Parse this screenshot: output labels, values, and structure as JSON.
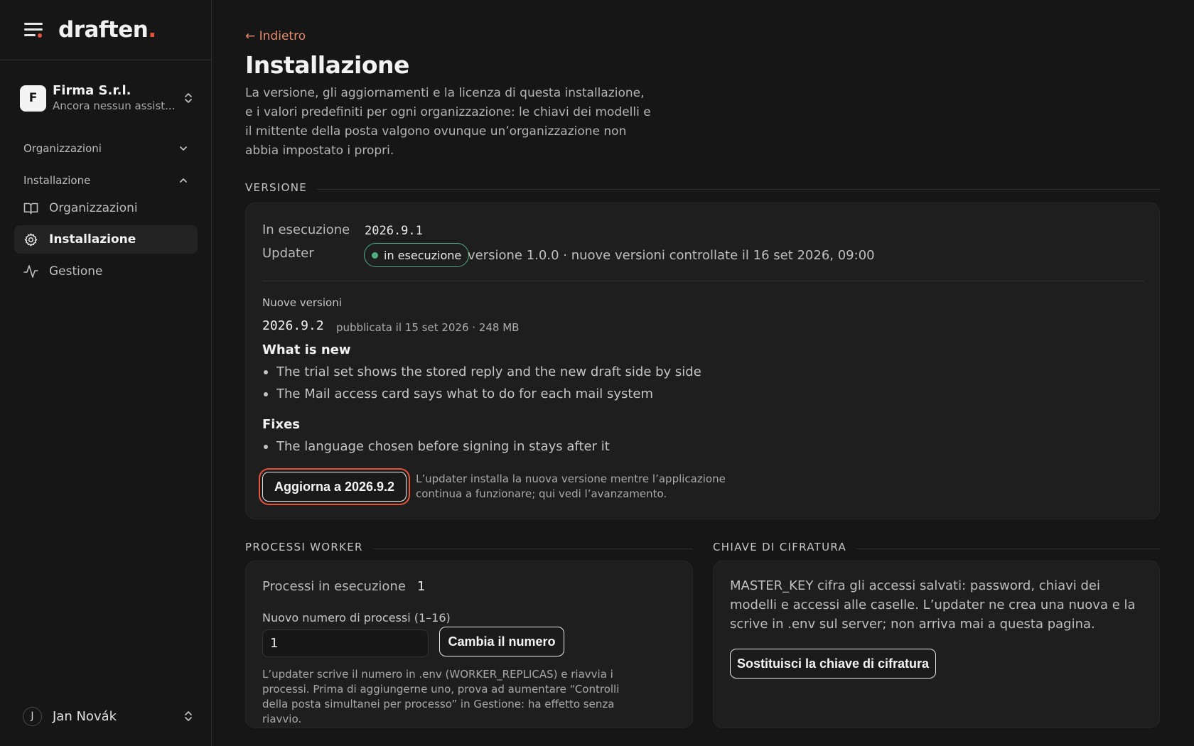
{
  "brand": {
    "name": "draften",
    "accent_color": "#e5533d"
  },
  "org": {
    "initial": "F",
    "name": "Firma S.r.l.",
    "subtitle": "Ancora nessun assist..."
  },
  "nav": {
    "sections": [
      {
        "label": "Organizzazioni",
        "expanded": false
      },
      {
        "label": "Installazione",
        "expanded": true
      }
    ],
    "items": [
      {
        "label": "Organizzazioni",
        "icon": "book-icon",
        "active": false
      },
      {
        "label": "Installazione",
        "icon": "gear-icon",
        "active": true
      },
      {
        "label": "Gestione",
        "icon": "activity-icon",
        "active": false
      }
    ]
  },
  "user": {
    "initial": "J",
    "name": "Jan Novák"
  },
  "page": {
    "back": "← Indietro",
    "title": "Installazione",
    "description": "La versione, gli aggiornamenti e la licenza di questa installazione, e i valori predefiniti per ogni organizzazione: le chiavi dei modelli e il mittente della posta valgono ovunque un’organizzazione non abbia impostato i propri."
  },
  "version": {
    "section_label": "VERSIONE",
    "running_label": "In esecuzione",
    "running_value": "2026.9.1",
    "updater_label": "Updater",
    "updater_status": "in esecuzione",
    "updater_status_color": "#4fae83",
    "updater_info": "versione 1.0.0 · nuove versioni controllate il 16 set 2026, 09:00",
    "new_versions_label": "Nuove versioni",
    "new_version": "2026.9.2",
    "new_version_meta": "pubblicata il 15 set 2026 · 248 MB",
    "whats_new_heading": "What is new",
    "whats_new": [
      "The trial set shows the stored reply and the new draft side by side",
      "The Mail access card says what to do for each mail system"
    ],
    "fixes_heading": "Fixes",
    "fixes": [
      "The language chosen before signing in stays after it"
    ],
    "update_button": "Aggiorna a 2026.9.2",
    "update_help": "L’updater installa la nuova versione mentre l’applicazione continua a funzionare; qui vedi l’avanzamento."
  },
  "workers": {
    "section_label": "PROCESSI WORKER",
    "running_label": "Processi in esecuzione",
    "running_value": "1",
    "new_count_label": "Nuovo numero di processi (1–16)",
    "new_count_value": "1",
    "change_button": "Cambia il numero",
    "help": "L’updater scrive il numero in .env (WORKER_REPLICAS) e riavvia i processi. Prima di aggiungerne uno, prova ad aumentare “Controlli della posta simultanei per processo” in Gestione: ha effetto senza riavvio."
  },
  "encryption": {
    "section_label": "CHIAVE DI CIFRATURA",
    "description": "MASTER_KEY cifra gli accessi salvati: password, chiavi dei modelli e accessi alle caselle. L’updater ne crea una nuova e la scrive in .env sul server; non arriva mai a questa pagina.",
    "replace_button": "Sostituisci la chiave di cifratura"
  }
}
